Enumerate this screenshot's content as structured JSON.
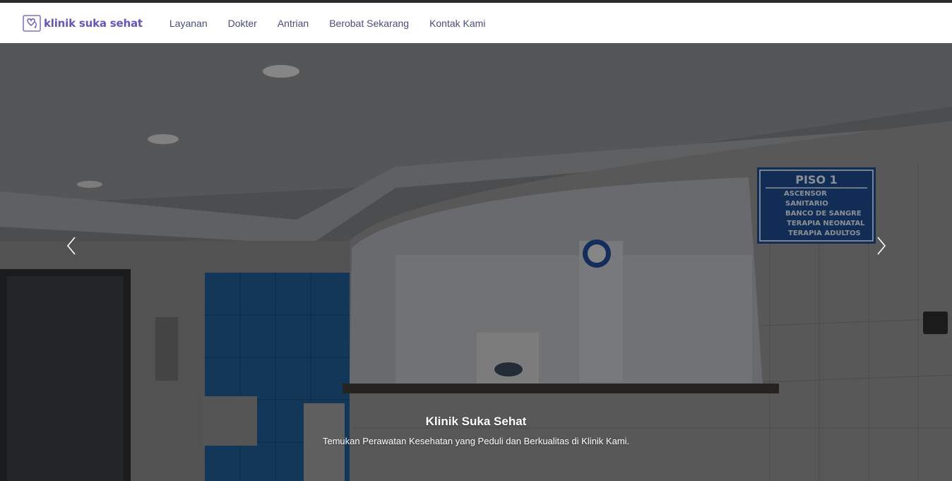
{
  "brand": {
    "name": "klinik suka sehat",
    "logo_icon": "heart-stethoscope-icon",
    "color": "#6258b8"
  },
  "nav": {
    "items": [
      {
        "label": "Layanan"
      },
      {
        "label": "Dokter"
      },
      {
        "label": "Antrian"
      },
      {
        "label": "Berobat Sekarang"
      },
      {
        "label": "Kontak Kami"
      }
    ]
  },
  "hero": {
    "image_sign": {
      "title": "PISO 1",
      "lines": [
        "ASCENSOR",
        "SANITARIO",
        "BANCO DE SANGRE",
        "TERAPIA NEONATAL",
        "TERAPIA ADULTOS"
      ]
    },
    "caption_title": "Klinik Suka Sehat",
    "caption_subtitle": "Temukan Perawatan Kesehatan yang Peduli dan Berkualitas di Klinik Kami.",
    "prev_icon": "chevron-left-icon",
    "next_icon": "chevron-right-icon"
  }
}
